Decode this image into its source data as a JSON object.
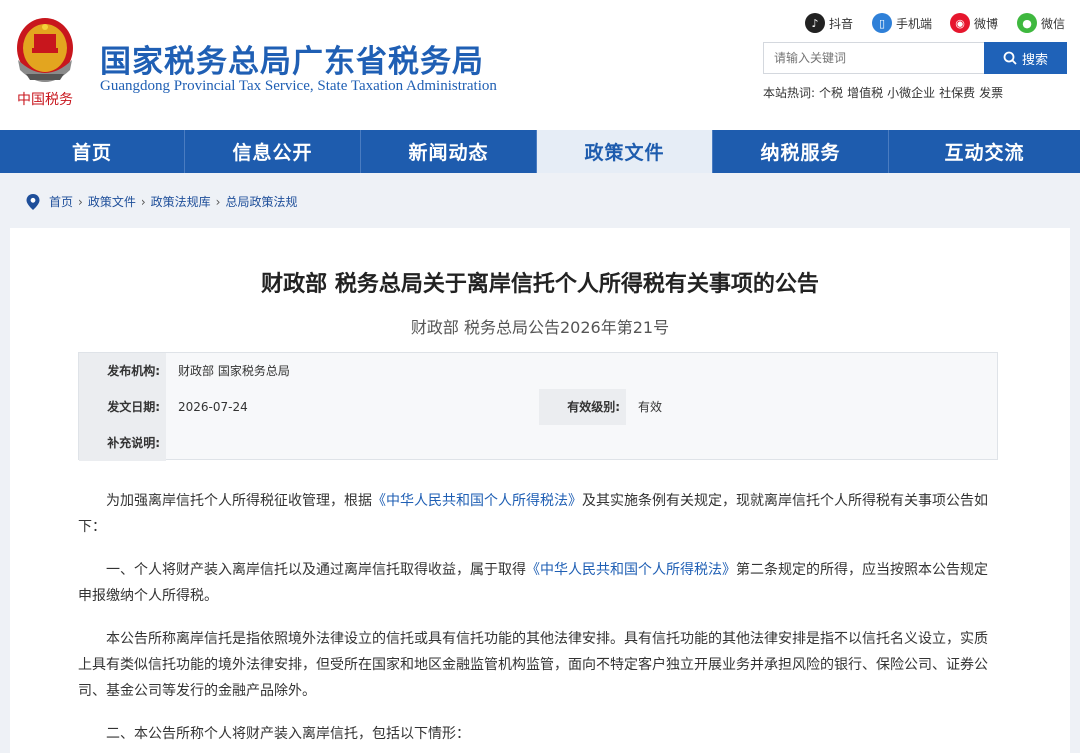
{
  "site": {
    "title": "国家税务总局广东省税务局",
    "subtitle": "Guangdong Provincial Tax Service, State Taxation Administration",
    "emblem_text": "中国税务"
  },
  "social": [
    {
      "icon": "douyin-icon",
      "label": "抖音",
      "color": "#222222"
    },
    {
      "icon": "mobile-icon",
      "label": "手机端",
      "color": "#2f80d8"
    },
    {
      "icon": "weibo-icon",
      "label": "微博",
      "color": "#e6162d"
    },
    {
      "icon": "wechat-icon",
      "label": "微信",
      "color": "#3fb83f"
    }
  ],
  "search": {
    "placeholder": "请输入关键词",
    "button": "搜索"
  },
  "hot": {
    "label": "本站热词:",
    "items": [
      "个税",
      "增值税",
      "小微企业",
      "社保费",
      "发票"
    ]
  },
  "nav": {
    "items": [
      "首页",
      "信息公开",
      "新闻动态",
      "政策文件",
      "纳税服务",
      "互动交流"
    ],
    "active": "政策文件"
  },
  "breadcrumb": [
    "首页",
    "政策文件",
    "政策法规库",
    "总局政策法规"
  ],
  "doc": {
    "title": "财政部 税务总局关于离岸信托个人所得税有关事项的公告",
    "subtitle": "财政部 税务总局公告2026年第21号",
    "meta": {
      "issuer_label": "发布机构:",
      "issuer": "财政部 国家税务总局",
      "date_label": "发文日期:",
      "date": "2026-07-24",
      "validity_label": "有效级别:",
      "validity": "有效",
      "note_label": "补充说明:",
      "note": ""
    },
    "paragraphs": {
      "p1_a": "为加强离岸信托个人所得税征收管理，根据",
      "p1_law": "《中华人民共和国个人所得税法》",
      "p1_b": "及其实施条例有关规定，现就离岸信托个人所得税有关事项公告如下：",
      "p2_a": "一、个人将财产装入离岸信托以及通过离岸信托取得收益，属于取得",
      "p2_law": "《中华人民共和国个人所得税法》",
      "p2_b": "第二条规定的所得，应当按照本公告规定申报缴纳个人所得税。",
      "p3": "本公告所称离岸信托是指依照境外法律设立的信托或具有信托功能的其他法律安排。具有信托功能的其他法律安排是指不以信托名义设立，实质上具有类似信托功能的境外法律安排，但受所在国家和地区金融监管机构监管，面向不特定客户独立开展业务并承担风险的银行、保险公司、证券公司、基金公司等发行的金融产品除外。",
      "p4": "二、本公告所称个人将财产装入离岸信托，包括以下情形："
    }
  },
  "colors": {
    "brand_blue": "#1e5cae",
    "nav_active_bg": "#e6edf6",
    "emblem_red": "#c8161d"
  }
}
